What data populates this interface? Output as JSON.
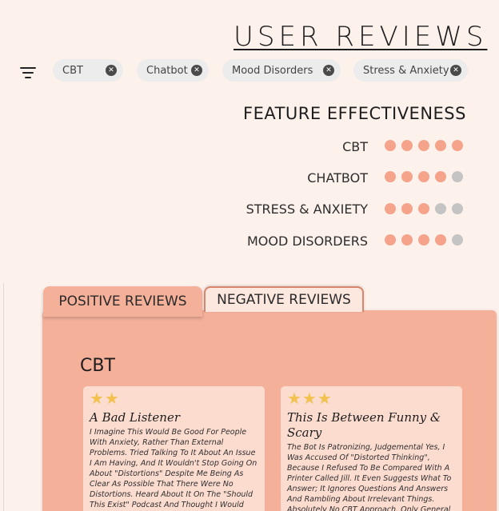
{
  "header": {
    "title": "USER REVIEWS"
  },
  "filters": [
    {
      "label": "CBT"
    },
    {
      "label": "Chatbot"
    },
    {
      "label": "Mood Disorders"
    },
    {
      "label": "Stress & Anxiety"
    }
  ],
  "effectiveness": {
    "title": "FEATURE EFFECTIVENESS",
    "rows": [
      {
        "label": "CBT",
        "rating": 5,
        "max": 5
      },
      {
        "label": "CHATBOT",
        "rating": 4,
        "max": 5
      },
      {
        "label": "STRESS & ANXIETY",
        "rating": 3,
        "max": 5
      },
      {
        "label": "MOOD DISORDERS",
        "rating": 4,
        "max": 5
      }
    ],
    "colors": {
      "filled": "#f5a48b",
      "empty": "#c4c4c4"
    }
  },
  "tabs": {
    "positive": "POSITIVE REVIEWS",
    "negative": "NEGATIVE REVIEWS",
    "active": "negative"
  },
  "section": {
    "label": "CBT"
  },
  "reviews": [
    {
      "stars": "★★",
      "title": "A Bad Listener",
      "body": "I Imagine This Would Be Good For People With Anxiety, Rather Than External Problems. Tried Talking To It About An Issue I Am Having, And It Wouldn't Stop Going On About \"Distortions\" Despite Me Being As Clear As Possible That There Were No Distortions. Heard About It On The \"Should This Exist\" Podcast And Thought I Would Give It A Go But Don't Think It's For Me"
    },
    {
      "stars": "★★★",
      "title": "This Is Between Funny & Scary",
      "body": "The Bot Is Patronizing, Judgemental Yes, I Was Accused Of \"Distorted Thinking\", Because I Refused To Be Compared With A Printer Called Jill. It Even Suggests What To Answer; It Ignores Questions And Answers And Rambling About Irrelevant Things. Absolutely No CBT Approach. Only General"
    }
  ]
}
